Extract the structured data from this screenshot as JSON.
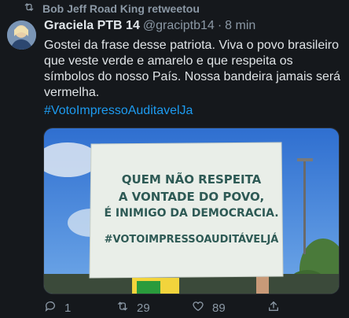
{
  "retweet_label": "Bob Jeff Road King retweetou",
  "tweet": {
    "author_name": "Graciela PTB 14",
    "author_handle": "@graciptb14",
    "separator": "·",
    "time": "8 min",
    "text": "Gostei da frase desse patriota. Viva o povo brasileiro que veste verde e amarelo e que respeita os símbolos do nosso País. Nossa bandeira jamais será vermelha.",
    "hashtag": "#VotoImpressoAuditavelJa"
  },
  "media": {
    "sign_line1": "QUEM NÃO RESPEITA",
    "sign_line2": "A VONTADE DO POVO,",
    "sign_line3": "É INIMIGO DA DEMOCRACIA.",
    "sign_line4": "#VOTOIMPRESSOAUDITÁVELJÁ"
  },
  "actions": {
    "replies": "1",
    "retweets": "29",
    "likes": "89"
  },
  "icons": {
    "retweet_header": "retweet-icon",
    "reply": "reply-icon",
    "retweet": "retweet-icon",
    "like": "heart-icon",
    "share": "share-icon"
  },
  "colors": {
    "background": "#15181c",
    "link": "#1d9bf0",
    "muted": "#8b98a5",
    "sign_text": "#2e5a55"
  }
}
